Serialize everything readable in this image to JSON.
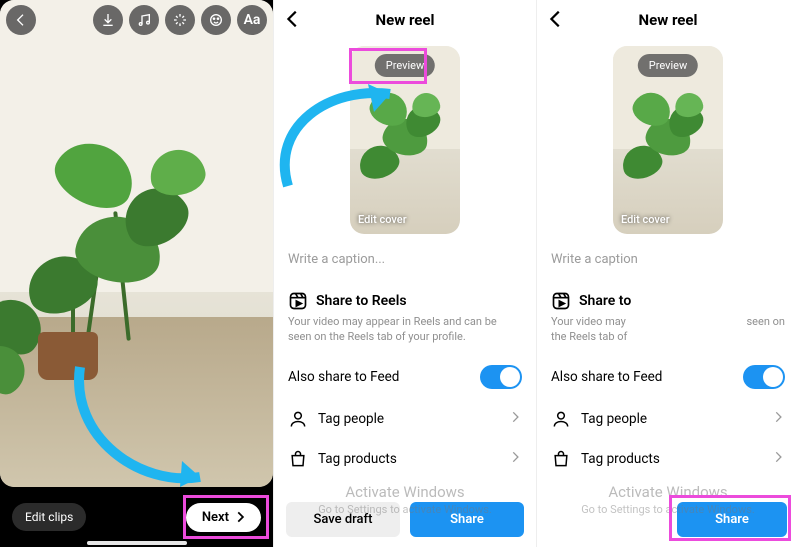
{
  "panel1": {
    "icons": [
      "back",
      "download",
      "music",
      "effects",
      "sticker",
      "text"
    ],
    "edit_clips_label": "Edit clips",
    "next_label": "Next"
  },
  "panel2": {
    "title": "New reel",
    "preview_label": "Preview",
    "edit_cover_label": "Edit cover",
    "caption_placeholder": "Write a caption...",
    "share_to_reels_label": "Share to Reels",
    "share_to_reels_desc": "Your video may appear in Reels and can be seen on the Reels tab of your profile.",
    "also_share_label": "Also share to Feed",
    "also_share_on": true,
    "tag_people_label": "Tag people",
    "tag_products_label": "Tag products",
    "save_draft_label": "Save draft",
    "share_label": "Share"
  },
  "panel3": {
    "title": "New reel",
    "preview_label": "Preview",
    "edit_cover_label": "Edit cover",
    "caption_placeholder": "Write a caption",
    "share_to_label": "Share to",
    "share_to_desc_left": "Your video may\nthe Reels tab of",
    "share_to_desc_right": "seen on",
    "also_share_label": "Also share to Feed",
    "also_share_on": true,
    "tag_people_label": "Tag people",
    "tag_products_label": "Tag products",
    "share_label": "Share"
  },
  "watermark": {
    "line1": "Activate Windows",
    "line2": "Go to Settings to activate Windows."
  }
}
